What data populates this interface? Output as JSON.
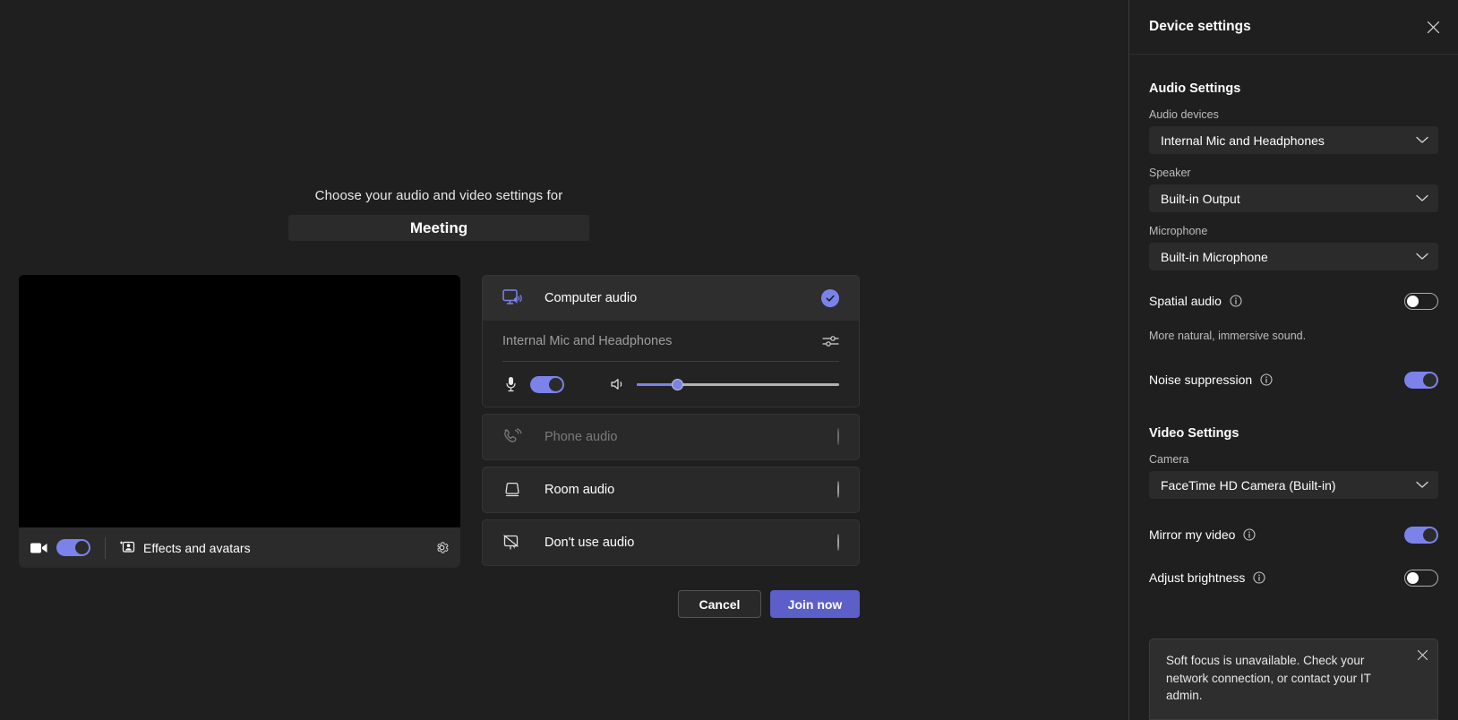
{
  "stage": {
    "subtitle": "Choose your audio and video settings for",
    "meeting_title": "Meeting"
  },
  "video_preview": {
    "camera_toggle_state": "on",
    "camera_icon": "video-camera-icon",
    "effects_label": "Effects and avatars",
    "effects_icon": "effects-avatars-icon",
    "settings_icon": "gear-icon"
  },
  "audio_options": {
    "computer": {
      "label": "Computer audio",
      "icon": "computer-speaker-icon",
      "selected": true,
      "check_icon": "checkmark-icon",
      "device_name": "Internal Mic and Headphones",
      "equalizer_icon": "audio-settings-sliders-icon",
      "mic_icon": "microphone-icon",
      "mic_toggle_state": "on",
      "speaker_icon": "speaker-volume-icon",
      "volume_percent": 20
    },
    "phone": {
      "label": "Phone audio",
      "icon": "phone-ring-icon",
      "disabled": true,
      "selected": false
    },
    "room": {
      "label": "Room audio",
      "icon": "room-device-icon",
      "disabled": false,
      "selected": false
    },
    "none": {
      "label": "Don't use audio",
      "icon": "no-audio-icon",
      "disabled": false,
      "selected": false
    }
  },
  "actions": {
    "cancel_label": "Cancel",
    "join_label": "Join now"
  },
  "panel": {
    "title": "Device settings",
    "close_icon": "close-icon",
    "audio_section": {
      "heading": "Audio Settings",
      "audio_devices_label": "Audio devices",
      "audio_devices_value": "Internal Mic and Headphones",
      "speaker_label": "Speaker",
      "speaker_value": "Built-in Output",
      "microphone_label": "Microphone",
      "microphone_value": "Built-in Microphone",
      "spatial_audio_label": "Spatial audio",
      "spatial_audio_state": "off",
      "spatial_audio_helper": "More natural, immersive sound.",
      "noise_suppression_label": "Noise suppression",
      "noise_suppression_state": "on"
    },
    "video_section": {
      "heading": "Video Settings",
      "camera_label": "Camera",
      "camera_value": "FaceTime HD Camera (Built-in)",
      "mirror_label": "Mirror my video",
      "mirror_state": "on",
      "brightness_label": "Adjust brightness",
      "brightness_state": "off"
    },
    "toast": {
      "message": "Soft focus is unavailable. Check your network connection, or contact your IT admin.",
      "close_icon": "close-icon"
    }
  },
  "colors": {
    "accent": "#7b83eb",
    "primary_button": "#5b5fc7",
    "panel_bg": "#1f1f1f"
  }
}
